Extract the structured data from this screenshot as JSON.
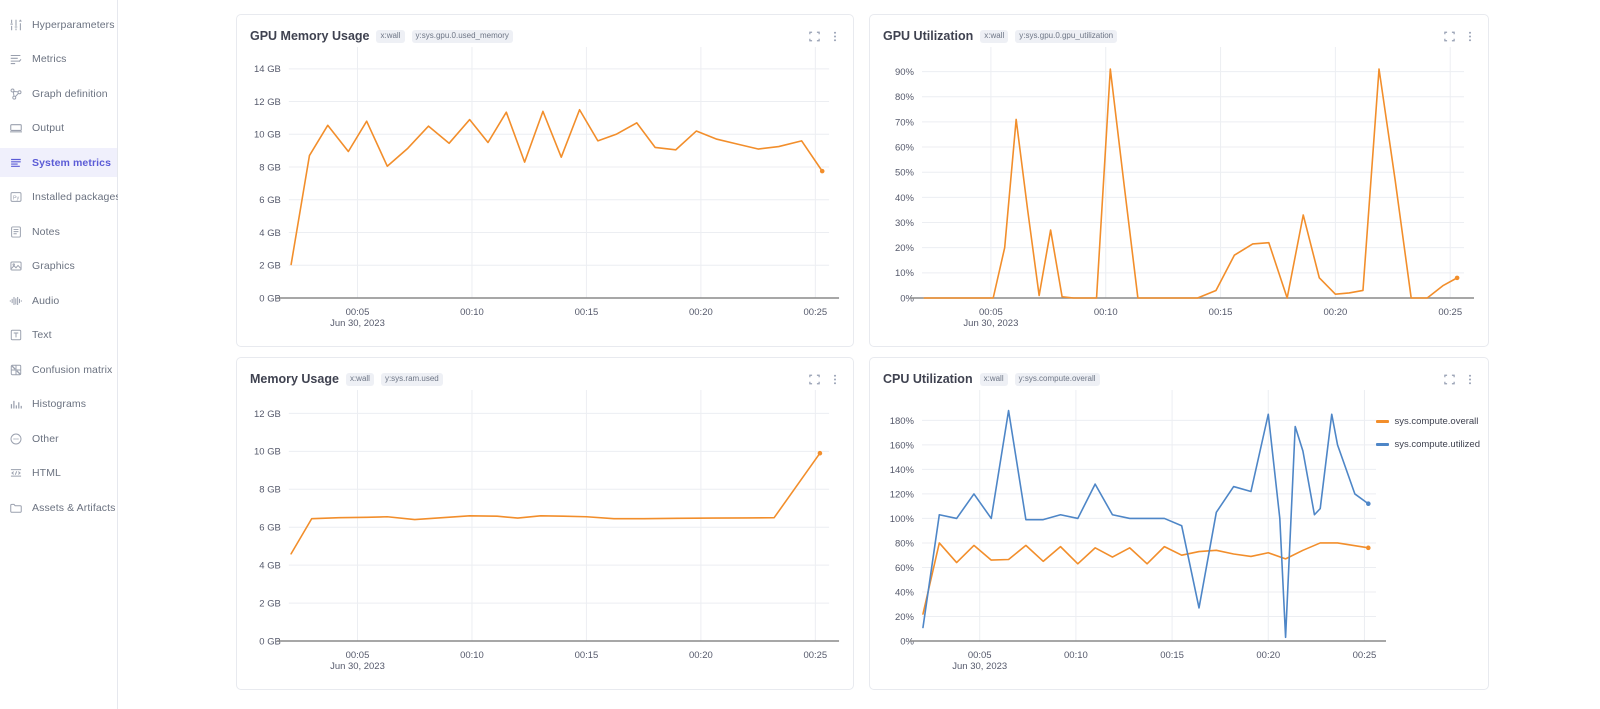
{
  "sidebar": {
    "items": [
      {
        "label": "Hyperparameters",
        "icon": "sliders-icon",
        "active": false
      },
      {
        "label": "Metrics",
        "icon": "metrics-list-icon",
        "active": false
      },
      {
        "label": "Graph definition",
        "icon": "graph-node-icon",
        "active": false
      },
      {
        "label": "Output",
        "icon": "console-icon",
        "active": false
      },
      {
        "label": "System metrics",
        "icon": "system-metrics-icon",
        "active": true
      },
      {
        "label": "Installed packages",
        "icon": "python-package-icon",
        "active": false
      },
      {
        "label": "Notes",
        "icon": "notes-icon",
        "active": false
      },
      {
        "label": "Graphics",
        "icon": "image-icon",
        "active": false
      },
      {
        "label": "Audio",
        "icon": "audio-wave-icon",
        "active": false
      },
      {
        "label": "Text",
        "icon": "text-icon",
        "active": false
      },
      {
        "label": "Confusion matrix",
        "icon": "confusion-matrix-icon",
        "active": false
      },
      {
        "label": "Histograms",
        "icon": "histogram-icon",
        "active": false
      },
      {
        "label": "Other",
        "icon": "other-circle-icon",
        "active": false
      },
      {
        "label": "HTML",
        "icon": "html-icon",
        "active": false
      },
      {
        "label": "Assets & Artifacts",
        "icon": "folder-icon",
        "active": false
      }
    ]
  },
  "panel_actions": {
    "expand_label": "expand-panel",
    "menu_label": "panel-menu"
  },
  "colors": {
    "orange": "#F28E2B",
    "blue": "#4E86C7",
    "axis": "#6b7280",
    "grid": "#eceef2",
    "baseline": "#8a8a8a",
    "accent": "#5b5bd6",
    "badge_bg": "#eef0f5"
  },
  "chart_data": [
    {
      "id": "gpu-memory-usage",
      "type": "line",
      "title": "GPU Memory Usage",
      "badges": [
        "x:wall",
        "y:sys.gpu.0.used_memory"
      ],
      "xlabel": "",
      "ylabel": "",
      "date_label": "Jun 30, 2023",
      "xticks": [
        "00:05",
        "00:10",
        "00:15",
        "00:20",
        "00:25"
      ],
      "xtick_minutes": [
        5,
        10,
        15,
        20,
        25
      ],
      "xlim": [
        2.0,
        25.6
      ],
      "yticks": [
        "0 GB",
        "2 GB",
        "4 GB",
        "6 GB",
        "8 GB",
        "10 GB",
        "12 GB",
        "14 GB"
      ],
      "ytick_values": [
        0,
        2,
        4,
        6,
        8,
        10,
        12,
        14
      ],
      "ylim": [
        0,
        14.6
      ],
      "grid": true,
      "legend": null,
      "series": [
        {
          "name": "sys.gpu.0.used_memory",
          "color": "#F28E2B",
          "end_marker": true,
          "x": [
            2.1,
            2.9,
            3.7,
            4.6,
            5.4,
            6.3,
            7.2,
            8.1,
            9.0,
            9.9,
            10.7,
            11.5,
            12.3,
            13.1,
            13.9,
            14.7,
            15.5,
            16.3,
            17.2,
            18.0,
            18.9,
            19.8,
            20.7,
            21.6,
            22.5,
            23.4,
            24.4,
            25.3
          ],
          "y": [
            2.05,
            8.7,
            10.55,
            8.95,
            10.8,
            8.05,
            9.15,
            10.5,
            9.45,
            10.9,
            9.5,
            11.35,
            8.3,
            11.4,
            8.6,
            11.5,
            9.6,
            10.0,
            10.7,
            9.2,
            9.05,
            10.2,
            9.7,
            9.4,
            9.1,
            9.25,
            9.6,
            7.75
          ]
        }
      ]
    },
    {
      "id": "gpu-utilization",
      "type": "line",
      "title": "GPU Utilization",
      "badges": [
        "x:wall",
        "y:sys.gpu.0.gpu_utilization"
      ],
      "xlabel": "",
      "ylabel": "",
      "date_label": "Jun 30, 2023",
      "xticks": [
        "00:05",
        "00:10",
        "00:15",
        "00:20",
        "00:25"
      ],
      "xtick_minutes": [
        5,
        10,
        15,
        20,
        25
      ],
      "xlim": [
        2.0,
        25.6
      ],
      "yticks": [
        "0%",
        "10%",
        "20%",
        "30%",
        "40%",
        "50%",
        "60%",
        "70%",
        "80%",
        "90%"
      ],
      "ytick_values": [
        0,
        10,
        20,
        30,
        40,
        50,
        60,
        70,
        80,
        90
      ],
      "ylim": [
        0,
        95
      ],
      "grid": true,
      "legend": null,
      "series": [
        {
          "name": "sys.gpu.0.gpu_utilization",
          "color": "#F28E2B",
          "end_marker": true,
          "x": [
            2.1,
            3.0,
            3.9,
            4.5,
            5.1,
            5.6,
            6.1,
            6.6,
            7.1,
            7.6,
            8.1,
            8.6,
            9.1,
            9.6,
            10.2,
            10.8,
            11.4,
            11.9,
            12.5,
            13.2,
            14.0,
            14.8,
            15.6,
            16.4,
            17.1,
            17.9,
            18.6,
            19.3,
            20.0,
            20.6,
            21.2,
            21.9,
            22.6,
            23.3,
            24.0,
            24.7,
            25.3
          ],
          "y": [
            0,
            0,
            0,
            0,
            0,
            20,
            71,
            35,
            1,
            27,
            0.5,
            0,
            0,
            0,
            91,
            45,
            0,
            0,
            0,
            0,
            0,
            3,
            17,
            21.5,
            22,
            0,
            33,
            8,
            1.5,
            2,
            3,
            91,
            47,
            0,
            0,
            5,
            8
          ]
        }
      ]
    },
    {
      "id": "memory-usage",
      "type": "line",
      "title": "Memory Usage",
      "badges": [
        "x:wall",
        "y:sys.ram.used"
      ],
      "xlabel": "",
      "ylabel": "",
      "date_label": "Jun 30, 2023",
      "xticks": [
        "00:05",
        "00:10",
        "00:15",
        "00:20",
        "00:25"
      ],
      "xtick_minutes": [
        5,
        10,
        15,
        20,
        25
      ],
      "xlim": [
        2.0,
        25.6
      ],
      "yticks": [
        "0 GB",
        "2 GB",
        "4 GB",
        "6 GB",
        "8 GB",
        "10 GB",
        "12 GB"
      ],
      "ytick_values": [
        0,
        2,
        4,
        6,
        8,
        10,
        12
      ],
      "ylim": [
        0,
        12.6
      ],
      "grid": true,
      "legend": null,
      "series": [
        {
          "name": "sys.ram.used",
          "color": "#F28E2B",
          "end_marker": true,
          "x": [
            2.1,
            3.0,
            4.2,
            5.4,
            6.3,
            7.5,
            8.7,
            9.9,
            11.1,
            12.0,
            13.0,
            14.0,
            15.0,
            16.2,
            17.5,
            19.0,
            20.5,
            22.0,
            23.2,
            25.2
          ],
          "y": [
            4.6,
            6.45,
            6.5,
            6.52,
            6.55,
            6.4,
            6.5,
            6.6,
            6.58,
            6.48,
            6.6,
            6.58,
            6.55,
            6.45,
            6.45,
            6.47,
            6.48,
            6.49,
            6.5,
            9.9
          ]
        }
      ]
    },
    {
      "id": "cpu-utilization",
      "type": "line",
      "title": "CPU Utilization",
      "badges": [
        "x:wall",
        "y:sys.compute.overall"
      ],
      "xlabel": "",
      "ylabel": "",
      "date_label": "Jun 30, 2023",
      "xticks": [
        "00:05",
        "00:10",
        "00:15",
        "00:20",
        "00:25"
      ],
      "xtick_minutes": [
        5,
        10,
        15,
        20,
        25
      ],
      "xlim": [
        2.0,
        25.6
      ],
      "yticks": [
        "0%",
        "20%",
        "40%",
        "60%",
        "80%",
        "100%",
        "120%",
        "140%",
        "160%",
        "180%"
      ],
      "ytick_values": [
        0,
        20,
        40,
        60,
        80,
        100,
        120,
        140,
        160,
        180
      ],
      "ylim": [
        0,
        195
      ],
      "grid": true,
      "legend": {
        "position": "right",
        "entries": [
          "sys.compute.overall",
          "sys.compute.utilized"
        ]
      },
      "series": [
        {
          "name": "sys.compute.overall",
          "color": "#F28E2B",
          "end_marker": true,
          "x": [
            2.05,
            2.9,
            3.8,
            4.7,
            5.6,
            6.5,
            7.4,
            8.3,
            9.2,
            10.1,
            11.0,
            11.9,
            12.8,
            13.7,
            14.6,
            15.5,
            16.4,
            17.3,
            18.2,
            19.1,
            20.0,
            20.9,
            21.8,
            22.7,
            23.6,
            25.2
          ],
          "y": [
            22,
            80,
            64,
            78,
            66,
            66.5,
            78,
            65,
            77,
            63,
            76,
            68.5,
            76,
            63,
            77,
            70,
            73,
            74,
            71,
            69,
            72,
            67,
            74,
            80,
            80,
            76
          ]
        },
        {
          "name": "sys.compute.utilized",
          "color": "#4E86C7",
          "end_marker": true,
          "x": [
            2.05,
            2.9,
            3.8,
            4.7,
            5.6,
            6.5,
            7.4,
            8.3,
            9.2,
            10.1,
            11.0,
            11.9,
            12.8,
            13.7,
            14.6,
            15.5,
            16.4,
            17.3,
            18.2,
            19.1,
            20.0,
            20.6,
            20.9,
            21.4,
            21.8,
            22.4,
            22.7,
            23.3,
            23.6,
            24.5,
            25.2
          ],
          "y": [
            11,
            103,
            100,
            120,
            100,
            188,
            99,
            99,
            103,
            100,
            128,
            103,
            100,
            100,
            100,
            94,
            27,
            105,
            126,
            122,
            185,
            100,
            3,
            175,
            155,
            103,
            108,
            185,
            160,
            120,
            112
          ]
        }
      ]
    }
  ]
}
